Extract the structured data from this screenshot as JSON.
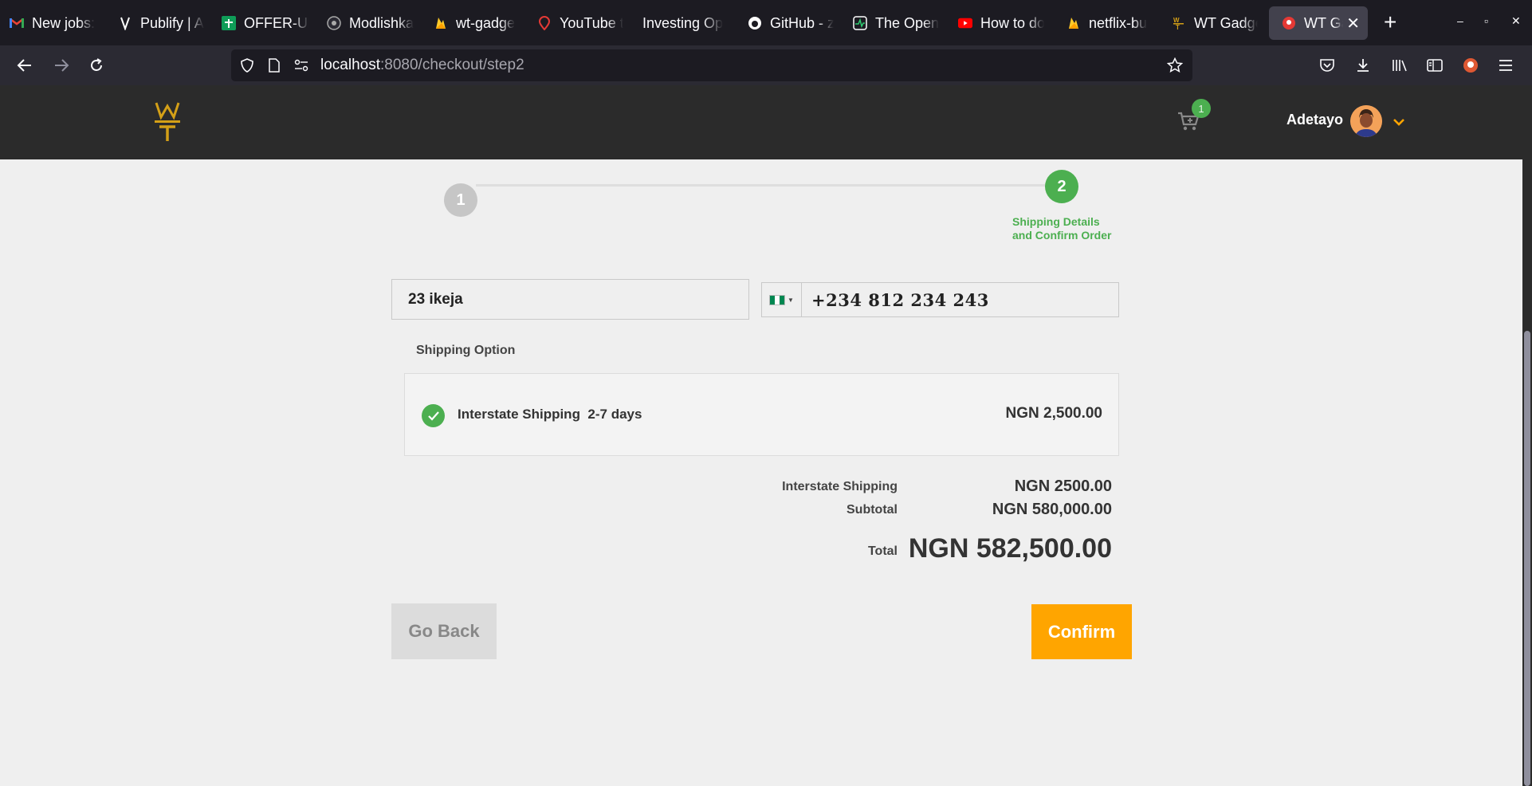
{
  "browser": {
    "tabs": [
      {
        "title": "New jobs: ",
        "icon": "gmail-icon"
      },
      {
        "title": "Publify | A",
        "icon": "publify-icon"
      },
      {
        "title": "OFFER-UF",
        "icon": "sheets-icon"
      },
      {
        "title": "Modlishka",
        "icon": "github-icon"
      },
      {
        "title": "wt-gadge",
        "icon": "firebase-icon"
      },
      {
        "title": "YouTube t",
        "icon": "location-pin-icon"
      },
      {
        "title": "Investing Op",
        "icon": "none"
      },
      {
        "title": "GitHub - z",
        "icon": "github-icon"
      },
      {
        "title": "The Open",
        "icon": "activity-icon"
      },
      {
        "title": "How to do",
        "icon": "youtube-icon"
      },
      {
        "title": "netflix-bu",
        "icon": "firebase-icon"
      },
      {
        "title": "WT Gadge",
        "icon": "wt-logo-icon"
      },
      {
        "title": "WT Gad",
        "icon": "wt-icon"
      }
    ],
    "url_host": "localhost",
    "url_rest": ":8080/checkout/step2"
  },
  "header": {
    "cart_count": "1",
    "username": "Adetayo"
  },
  "stepper": {
    "step1_number": "1",
    "step2_number": "2",
    "step2_label": "Shipping Details and Confirm Order"
  },
  "form": {
    "address_value": "23 ikeja",
    "phone_value": "+234 812 234 243"
  },
  "shipping": {
    "section_title": "Shipping Option",
    "option_name": "Interstate Shipping  2-7 days",
    "option_price": "NGN 2,500.00"
  },
  "summary": {
    "shipping_label": "Interstate Shipping",
    "shipping_value": "NGN 2500.00",
    "subtotal_label": "Subtotal",
    "subtotal_value": "NGN 580,000.00",
    "total_label": "Total",
    "total_value": "NGN 582,500.00"
  },
  "actions": {
    "back_label": "Go Back",
    "confirm_label": "Confirm"
  },
  "colors": {
    "accent_orange": "#ffa500",
    "success_green": "#4caf50",
    "header_bg": "#2b2b2b"
  }
}
